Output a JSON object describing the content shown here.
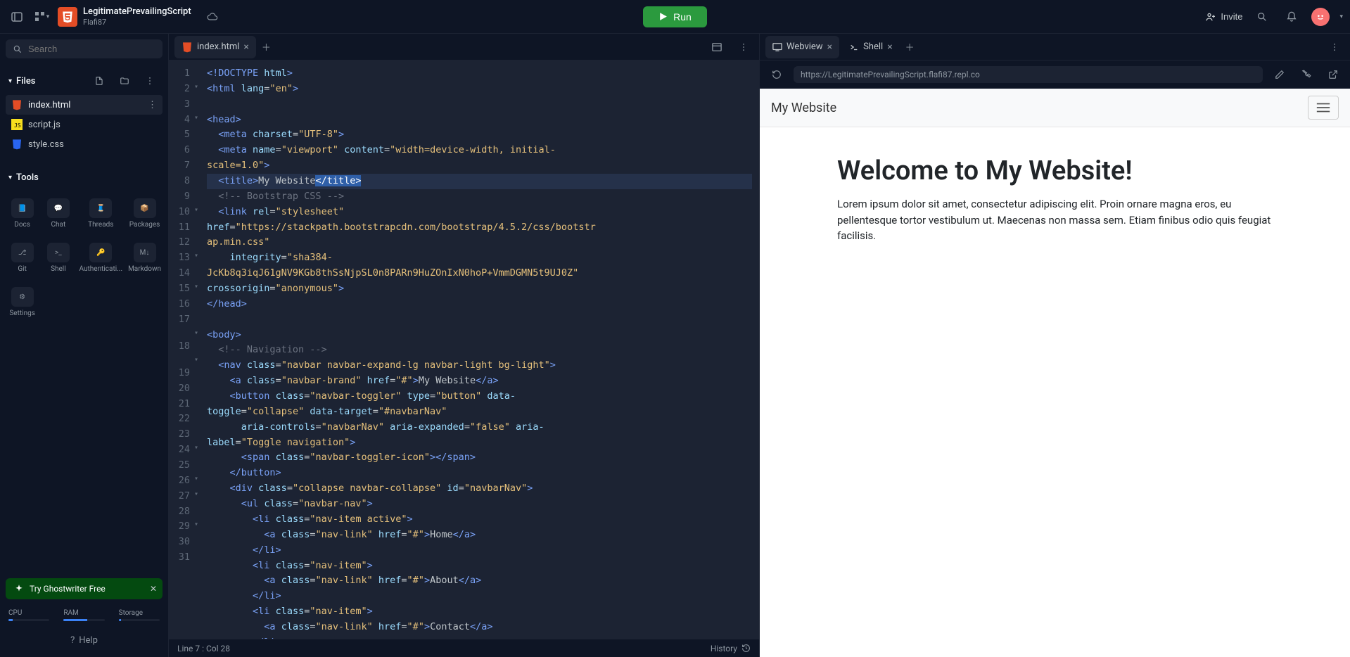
{
  "project": {
    "name": "LegitimatePrevailingScript",
    "owner": "Flafi87"
  },
  "topbar": {
    "run": "Run",
    "invite": "Invite"
  },
  "sidebar": {
    "search_placeholder": "Search",
    "files_label": "Files",
    "files": [
      {
        "name": "index.html",
        "active": true,
        "icon": "html"
      },
      {
        "name": "script.js",
        "active": false,
        "icon": "js"
      },
      {
        "name": "style.css",
        "active": false,
        "icon": "css"
      }
    ],
    "tools_label": "Tools",
    "tools": [
      "Docs",
      "Chat",
      "Threads",
      "Packages",
      "Git",
      "Shell",
      "Authenticati...",
      "Markdown",
      "Settings"
    ],
    "ghostwriter": "Try Ghostwriter Free",
    "resources": {
      "cpu": {
        "label": "CPU",
        "pct": 10
      },
      "ram": {
        "label": "RAM",
        "pct": 58
      },
      "storage": {
        "label": "Storage",
        "pct": 6
      }
    },
    "help": "Help"
  },
  "editor": {
    "tabs": [
      {
        "label": "index.html",
        "active": true
      }
    ],
    "gutter": [
      "1",
      "2",
      "3",
      "4",
      "5",
      "6",
      "",
      "7",
      "8",
      "9",
      "",
      "",
      "10",
      "",
      "",
      "11",
      "12",
      "13",
      "14",
      "15",
      "16",
      "17",
      "",
      "18",
      "",
      "19",
      "20",
      "21",
      "22",
      "23",
      "24",
      "25",
      "26",
      "27",
      "28",
      "29",
      "30",
      "31"
    ],
    "fold_rows": [
      1,
      3,
      12,
      17,
      19,
      22,
      24,
      30,
      32,
      33,
      35,
      38
    ],
    "code_html": [
      "<span class='t-tag'>&lt;!DOCTYPE</span> <span class='t-attr'>html</span><span class='t-tag'>&gt;</span>",
      "<span class='t-tag'>&lt;html</span> <span class='t-attr'>lang</span>=<span class='t-str'>\"en\"</span><span class='t-tag'>&gt;</span>",
      "",
      "<span class='t-tag'>&lt;head&gt;</span>",
      "  <span class='t-tag'>&lt;meta</span> <span class='t-attr'>charset</span>=<span class='t-str'>\"UTF-8\"</span><span class='t-tag'>&gt;</span>",
      "  <span class='t-tag'>&lt;meta</span> <span class='t-attr'>name</span>=<span class='t-str'>\"viewport\"</span> <span class='t-attr'>content</span>=<span class='t-str'>\"width=device-width, initial-</span>",
      "<span class='t-str'>scale=1.0\"</span><span class='t-tag'>&gt;</span>",
      "  <span class='t-tag'>&lt;title&gt;</span><span class='t-txt'>My Website</span><span class='t-sel'>&lt;/title&gt;</span>",
      "  <span class='t-cmt'>&lt;!-- Bootstrap CSS --&gt;</span>",
      "  <span class='t-tag'>&lt;link</span> <span class='t-attr'>rel</span>=<span class='t-str'>\"stylesheet\"</span>",
      "<span class='t-attr'>href</span>=<span class='t-str'>\"https://stackpath.bootstrapcdn.com/bootstrap/4.5.2/css/bootstr</span>",
      "<span class='t-str'>ap.min.css\"</span>",
      "    <span class='t-attr'>integrity</span>=<span class='t-str'>\"sha384-</span>",
      "<span class='t-str'>JcKb8q3iqJ61gNV9KGb8thSsNjpSL0n8PARn9HuZOnIxN0hoP+VmmDGMN5t9UJ0Z\"</span>",
      "<span class='t-attr'>crossorigin</span>=<span class='t-str'>\"anonymous\"</span><span class='t-tag'>&gt;</span>",
      "<span class='t-tag'>&lt;/head&gt;</span>",
      "",
      "<span class='t-tag'>&lt;body&gt;</span>",
      "  <span class='t-cmt'>&lt;!-- Navigation --&gt;</span>",
      "  <span class='t-tag'>&lt;nav</span> <span class='t-attr'>class</span>=<span class='t-str'>\"navbar navbar-expand-lg navbar-light bg-light\"</span><span class='t-tag'>&gt;</span>",
      "    <span class='t-tag'>&lt;a</span> <span class='t-attr'>class</span>=<span class='t-str'>\"navbar-brand\"</span> <span class='t-attr'>href</span>=<span class='t-str'>\"#\"</span><span class='t-tag'>&gt;</span><span class='t-txt'>My Website</span><span class='t-tag'>&lt;/a&gt;</span>",
      "    <span class='t-tag'>&lt;button</span> <span class='t-attr'>class</span>=<span class='t-str'>\"navbar-toggler\"</span> <span class='t-attr'>type</span>=<span class='t-str'>\"button\"</span> <span class='t-attr'>data-</span>",
      "<span class='t-attr'>toggle</span>=<span class='t-str'>\"collapse\"</span> <span class='t-attr'>data-target</span>=<span class='t-str'>\"#navbarNav\"</span>",
      "      <span class='t-attr'>aria-controls</span>=<span class='t-str'>\"navbarNav\"</span> <span class='t-attr'>aria-expanded</span>=<span class='t-str'>\"false\"</span> <span class='t-attr'>aria-</span>",
      "<span class='t-attr'>label</span>=<span class='t-str'>\"Toggle navigation\"</span><span class='t-tag'>&gt;</span>",
      "      <span class='t-tag'>&lt;span</span> <span class='t-attr'>class</span>=<span class='t-str'>\"navbar-toggler-icon\"</span><span class='t-tag'>&gt;&lt;/span&gt;</span>",
      "    <span class='t-tag'>&lt;/button&gt;</span>",
      "    <span class='t-tag'>&lt;div</span> <span class='t-attr'>class</span>=<span class='t-str'>\"collapse navbar-collapse\"</span> <span class='t-attr'>id</span>=<span class='t-str'>\"navbarNav\"</span><span class='t-tag'>&gt;</span>",
      "      <span class='t-tag'>&lt;ul</span> <span class='t-attr'>class</span>=<span class='t-str'>\"navbar-nav\"</span><span class='t-tag'>&gt;</span>",
      "        <span class='t-tag'>&lt;li</span> <span class='t-attr'>class</span>=<span class='t-str'>\"nav-item active\"</span><span class='t-tag'>&gt;</span>",
      "          <span class='t-tag'>&lt;a</span> <span class='t-attr'>class</span>=<span class='t-str'>\"nav-link\"</span> <span class='t-attr'>href</span>=<span class='t-str'>\"#\"</span><span class='t-tag'>&gt;</span><span class='t-txt'>Home</span><span class='t-tag'>&lt;/a&gt;</span>",
      "        <span class='t-tag'>&lt;/li&gt;</span>",
      "        <span class='t-tag'>&lt;li</span> <span class='t-attr'>class</span>=<span class='t-str'>\"nav-item\"</span><span class='t-tag'>&gt;</span>",
      "          <span class='t-tag'>&lt;a</span> <span class='t-attr'>class</span>=<span class='t-str'>\"nav-link\"</span> <span class='t-attr'>href</span>=<span class='t-str'>\"#\"</span><span class='t-tag'>&gt;</span><span class='t-txt'>About</span><span class='t-tag'>&lt;/a&gt;</span>",
      "        <span class='t-tag'>&lt;/li&gt;</span>",
      "        <span class='t-tag'>&lt;li</span> <span class='t-attr'>class</span>=<span class='t-str'>\"nav-item\"</span><span class='t-tag'>&gt;</span>",
      "          <span class='t-tag'>&lt;a</span> <span class='t-attr'>class</span>=<span class='t-str'>\"nav-link\"</span> <span class='t-attr'>href</span>=<span class='t-str'>\"#\"</span><span class='t-tag'>&gt;</span><span class='t-txt'>Contact</span><span class='t-tag'>&lt;/a&gt;</span>",
      "        <span class='t-tag'>&lt;/li&gt;</span>"
    ],
    "highlight_row": 7,
    "status_left": "Line 7 : Col 28",
    "status_right": "History"
  },
  "preview": {
    "tabs": [
      {
        "label": "Webview",
        "active": true
      },
      {
        "label": "Shell",
        "active": false
      }
    ],
    "url": "https://LegitimatePrevailingScript.flafi87.repl.co",
    "brand": "My Website",
    "heading": "Welcome to My Website!",
    "body": "Lorem ipsum dolor sit amet, consectetur adipiscing elit. Proin ornare magna eros, eu pellentesque tortor vestibulum ut. Maecenas non massa sem. Etiam finibus odio quis feugiat facilisis."
  }
}
